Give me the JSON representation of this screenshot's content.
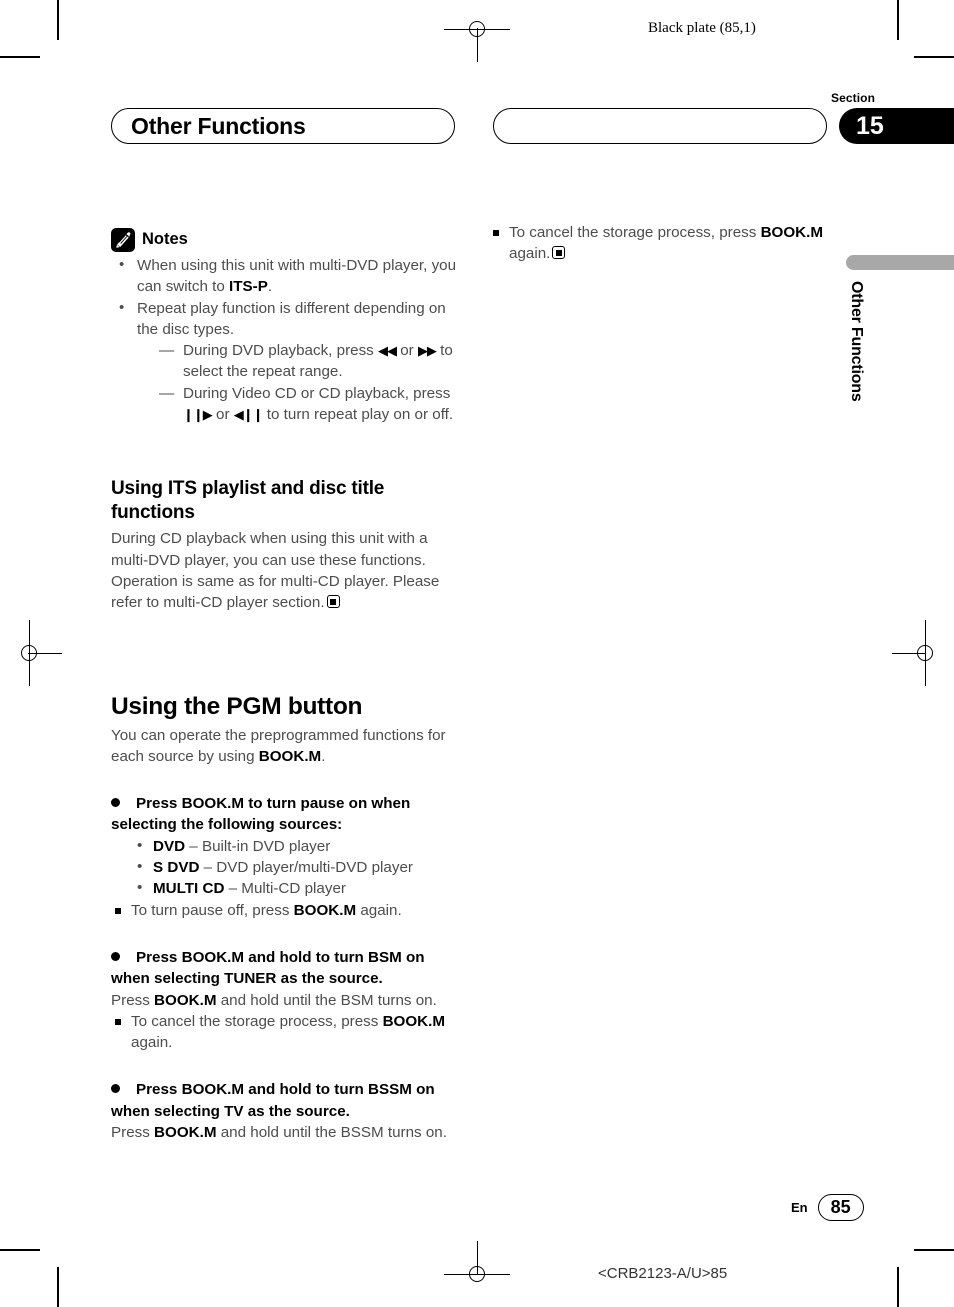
{
  "page": {
    "black_plate": "Black plate (85,1)",
    "footer_code": "<CRB2123-A/U>85",
    "page_number": "85",
    "language_code": "En"
  },
  "header": {
    "chapter_title": "Other Functions",
    "section_word": "Section",
    "section_number": "15",
    "side_tab_label": "Other Functions"
  },
  "left_column": {
    "notes": {
      "icon": "pencil-icon",
      "label": "Notes",
      "items": [
        {
          "text_a": "When using this unit with multi-DVD player, you can switch to ",
          "bold_a": "ITS-P",
          "text_b": "."
        },
        {
          "text_a": "Repeat play function is different depending on the disc types.",
          "sub_items": [
            {
              "text_a": "During DVD playback, press ",
              "glyph_a": "◀◀",
              "text_b": " or ",
              "glyph_b": "▶▶",
              "text_c": " to select the repeat range."
            },
            {
              "text_a": "During Video CD or CD playback, press ",
              "glyph_a": "❙❙▶",
              "text_b": " or ",
              "glyph_b": "◀❙❙",
              "text_c": " to turn repeat play on or off."
            }
          ]
        }
      ]
    },
    "its_section": {
      "heading": "Using ITS playlist and disc title functions",
      "body": "During CD playback when using this unit with a multi-DVD player, you can use these functions. Operation is same as for multi-CD player. Please refer to multi-CD player section."
    },
    "pgm_section": {
      "heading": "Using the PGM button",
      "intro_a": "You can operate the preprogrammed functions for each source by using ",
      "intro_bold": "BOOK.M",
      "intro_b": ".",
      "action1": {
        "heading": "Press BOOK.M to turn pause on when selecting the following sources:",
        "sources": [
          {
            "name": "DVD",
            "desc": " – Built-in DVD player"
          },
          {
            "name": "S DVD",
            "desc": " – DVD player/multi-DVD player"
          },
          {
            "name": "MULTI CD",
            "desc": " – Multi-CD player"
          }
        ],
        "note_a": "To turn pause off, press ",
        "note_bold": "BOOK.M",
        "note_b": " again."
      },
      "action2": {
        "heading": "Press BOOK.M and hold to turn BSM on when selecting TUNER as the source.",
        "body_a": "Press ",
        "body_bold": "BOOK.M",
        "body_b": " and hold until the BSM turns on.",
        "note_a": "To cancel the storage process, press ",
        "note_bold": "BOOK.M",
        "note_b": " again."
      },
      "action3": {
        "heading": "Press BOOK.M and hold to turn BSSM on when selecting TV as the source.",
        "body_a": "Press ",
        "body_bold": "BOOK.M",
        "body_b": " and hold until the BSSM turns on."
      }
    }
  },
  "right_column": {
    "note_a": "To cancel the storage process, press ",
    "note_bold": "BOOK.M",
    "note_b": " again."
  },
  "colors": {
    "body_text": "#4d4d4d",
    "heading_text": "#000000",
    "tab_gray": "#a8a8a8",
    "badge_black": "#000000"
  }
}
